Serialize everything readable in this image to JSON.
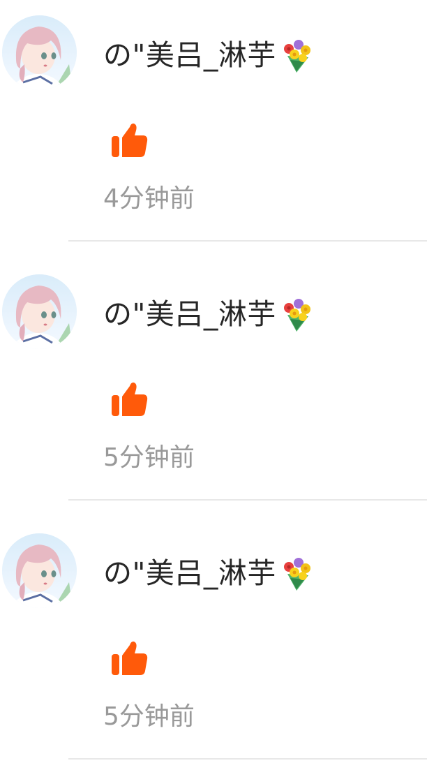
{
  "notifications": [
    {
      "username": "の\"美吕_淋芋",
      "badge_icon": "bouquet-icon",
      "action_icon": "thumbs-up-icon",
      "time": "4分钟前"
    },
    {
      "username": "の\"美吕_淋芋",
      "badge_icon": "bouquet-icon",
      "action_icon": "thumbs-up-icon",
      "time": "5分钟前"
    },
    {
      "username": "の\"美吕_淋芋",
      "badge_icon": "bouquet-icon",
      "action_icon": "thumbs-up-icon",
      "time": "5分钟前"
    }
  ],
  "colors": {
    "like": "#ff5a0a",
    "name_text": "#262626",
    "time_text": "#999999",
    "divider": "#e8e8e8"
  }
}
